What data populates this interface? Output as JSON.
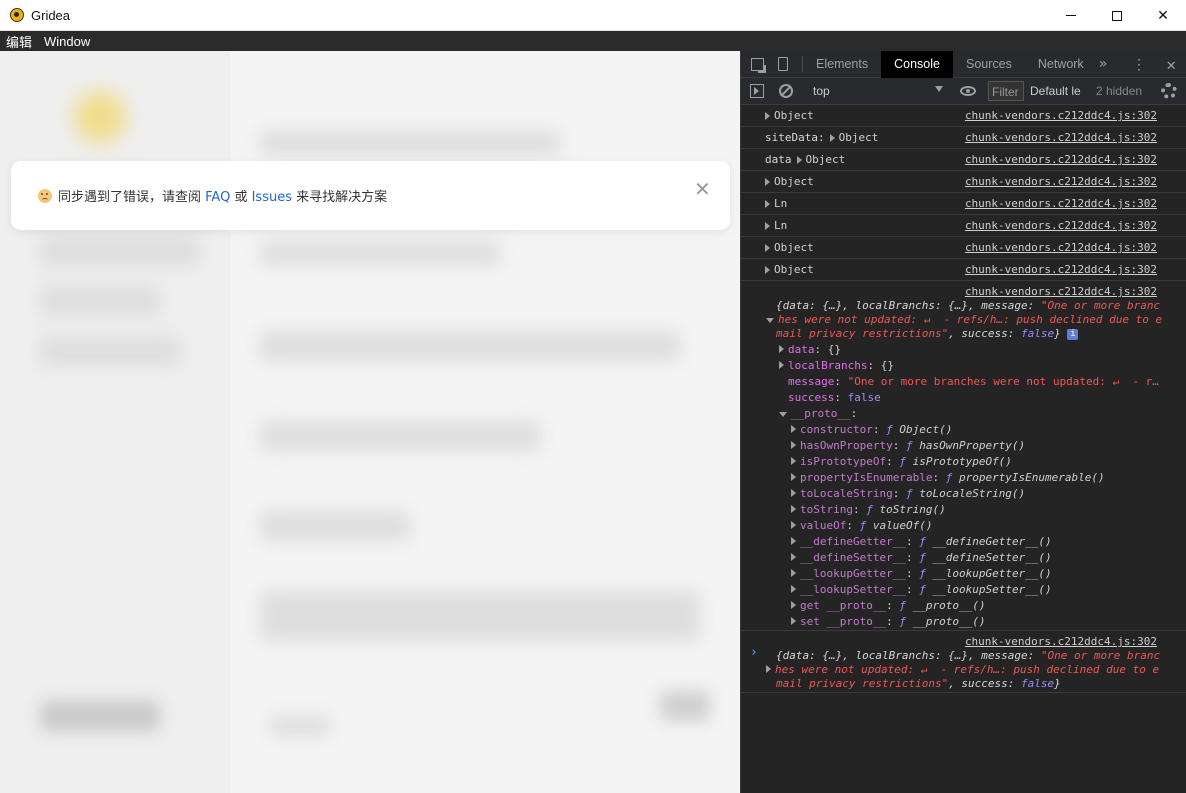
{
  "window": {
    "title": "Gridea"
  },
  "menubar": {
    "items": [
      "编辑",
      "Window"
    ]
  },
  "notice": {
    "prefix": "同步遇到了错误，请查阅 ",
    "faq": "FAQ",
    "middle": " 或 ",
    "issues": "Issues",
    "suffix": " 来寻找解决方案"
  },
  "devtools": {
    "tabs": [
      "Elements",
      "Console",
      "Sources",
      "Network"
    ],
    "active_tab": "Console",
    "more": "»",
    "context": "top",
    "filter_placeholder": "Filter",
    "levels": "Default le",
    "hidden": "2 hidden"
  },
  "console": {
    "source": "chunk-vendors.c212ddc4.js:302",
    "rows": [
      {
        "label": "",
        "value": "Object"
      },
      {
        "label": "siteData:",
        "value": "Object"
      },
      {
        "label": "data",
        "value": "Object"
      },
      {
        "label": "",
        "value": "Object"
      },
      {
        "label": "",
        "value": "Ln"
      },
      {
        "label": "",
        "value": "Ln"
      },
      {
        "label": "",
        "value": "Object"
      },
      {
        "label": "",
        "value": "Object"
      }
    ],
    "expanded": {
      "summary_1": "{data: {…}, localBranchs: {…}, message: ",
      "summary_msg_1": "\"One or more branc",
      "summary_msg_2": "hes were not updated: ↵  - refs/h…: push declined due to e",
      "summary_msg_3": "mail privacy restrictions\"",
      "summary_tail": ", success: ",
      "summary_false": "false",
      "summary_close": "}",
      "info": "i",
      "props": [
        {
          "key": "data",
          "value": "{}"
        },
        {
          "key": "localBranchs",
          "value": "{}"
        },
        {
          "key": "message",
          "value": "\"One or more branches were not updated: ↵  - r…"
        },
        {
          "key": "success",
          "value": "false"
        },
        {
          "key": "__proto__",
          "value": ""
        }
      ],
      "proto": [
        {
          "key": "constructor",
          "fn": "Object()"
        },
        {
          "key": "hasOwnProperty",
          "fn": "hasOwnProperty()"
        },
        {
          "key": "isPrototypeOf",
          "fn": "isPrototypeOf()"
        },
        {
          "key": "propertyIsEnumerable",
          "fn": "propertyIsEnumerable()"
        },
        {
          "key": "toLocaleString",
          "fn": "toLocaleString()"
        },
        {
          "key": "toString",
          "fn": "toString()"
        },
        {
          "key": "valueOf",
          "fn": "valueOf()"
        },
        {
          "key": "__defineGetter__",
          "fn": "__defineGetter__()"
        },
        {
          "key": "__defineSetter__",
          "fn": "__defineSetter__()"
        },
        {
          "key": "__lookupGetter__",
          "fn": "__lookupGetter__()"
        },
        {
          "key": "__lookupSetter__",
          "fn": "__lookupSetter__()"
        },
        {
          "key": "get __proto__",
          "fn": "__proto__()"
        },
        {
          "key": "set __proto__",
          "fn": "__proto__()"
        }
      ],
      "f": "ƒ"
    },
    "prompt": "›"
  }
}
